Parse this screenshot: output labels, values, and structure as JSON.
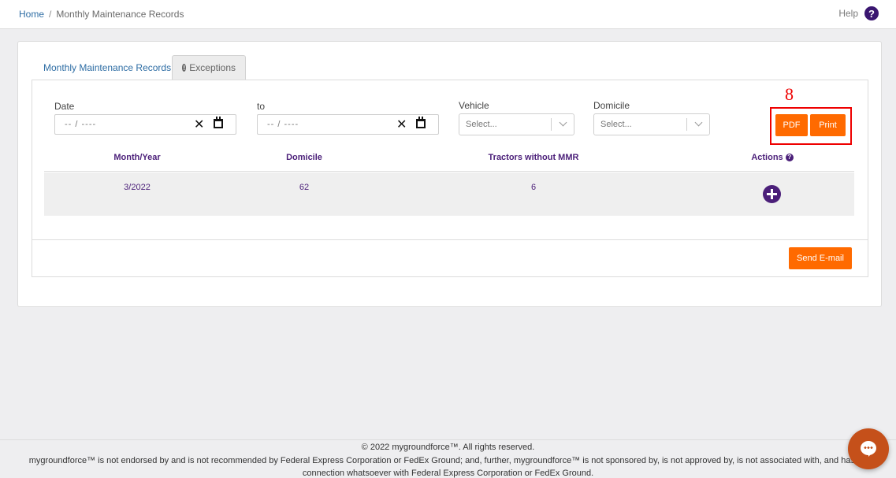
{
  "breadcrumb": {
    "home": "Home",
    "separator": "/",
    "current": "Monthly Maintenance Records"
  },
  "help": {
    "label": "Help",
    "icon": "question-circle-icon",
    "glyph": "?"
  },
  "tabs": [
    {
      "label": "Monthly Maintenance Records"
    },
    {
      "label": "Exceptions",
      "icon": "exclamation-circle-icon"
    }
  ],
  "filters": {
    "date_label": "Date",
    "date_placeholder": "-- / ----",
    "to_label": "to",
    "to_placeholder": "-- / ----",
    "clear_glyph": "✕",
    "vehicle_label": "Vehicle",
    "vehicle_placeholder": "Select...",
    "domicile_label": "Domicile",
    "domicile_placeholder": "Select..."
  },
  "annotation": {
    "number": "8",
    "color": "#ee0000"
  },
  "buttons": {
    "pdf": "PDF",
    "print": "Print",
    "send_email": "Send E-mail",
    "color": "#ff6a00"
  },
  "table": {
    "headers": [
      "Month/Year",
      "Domicile",
      "Tractors without MMR",
      "Actions"
    ],
    "rows": [
      {
        "month_year": "3/2022",
        "domicile": "62",
        "tractors_without_mmr": "6"
      }
    ]
  },
  "footer": {
    "copyright": "© 2022 mygroundforce™. All rights reserved.",
    "disclaimer_line1": "mygroundforce™ is not endorsed by and is not recommended by Federal Express Corporation or FedEx Ground; and, further, mygroundforce™ is not sponsored by, is not approved by, is not associated with, and has no",
    "disclaimer_line2": "connection whatsoever with Federal Express Corporation or FedEx Ground."
  },
  "colors": {
    "brand_purple": "#4b1f79",
    "link_blue": "#2e6da4",
    "chat": "#c5501a"
  }
}
